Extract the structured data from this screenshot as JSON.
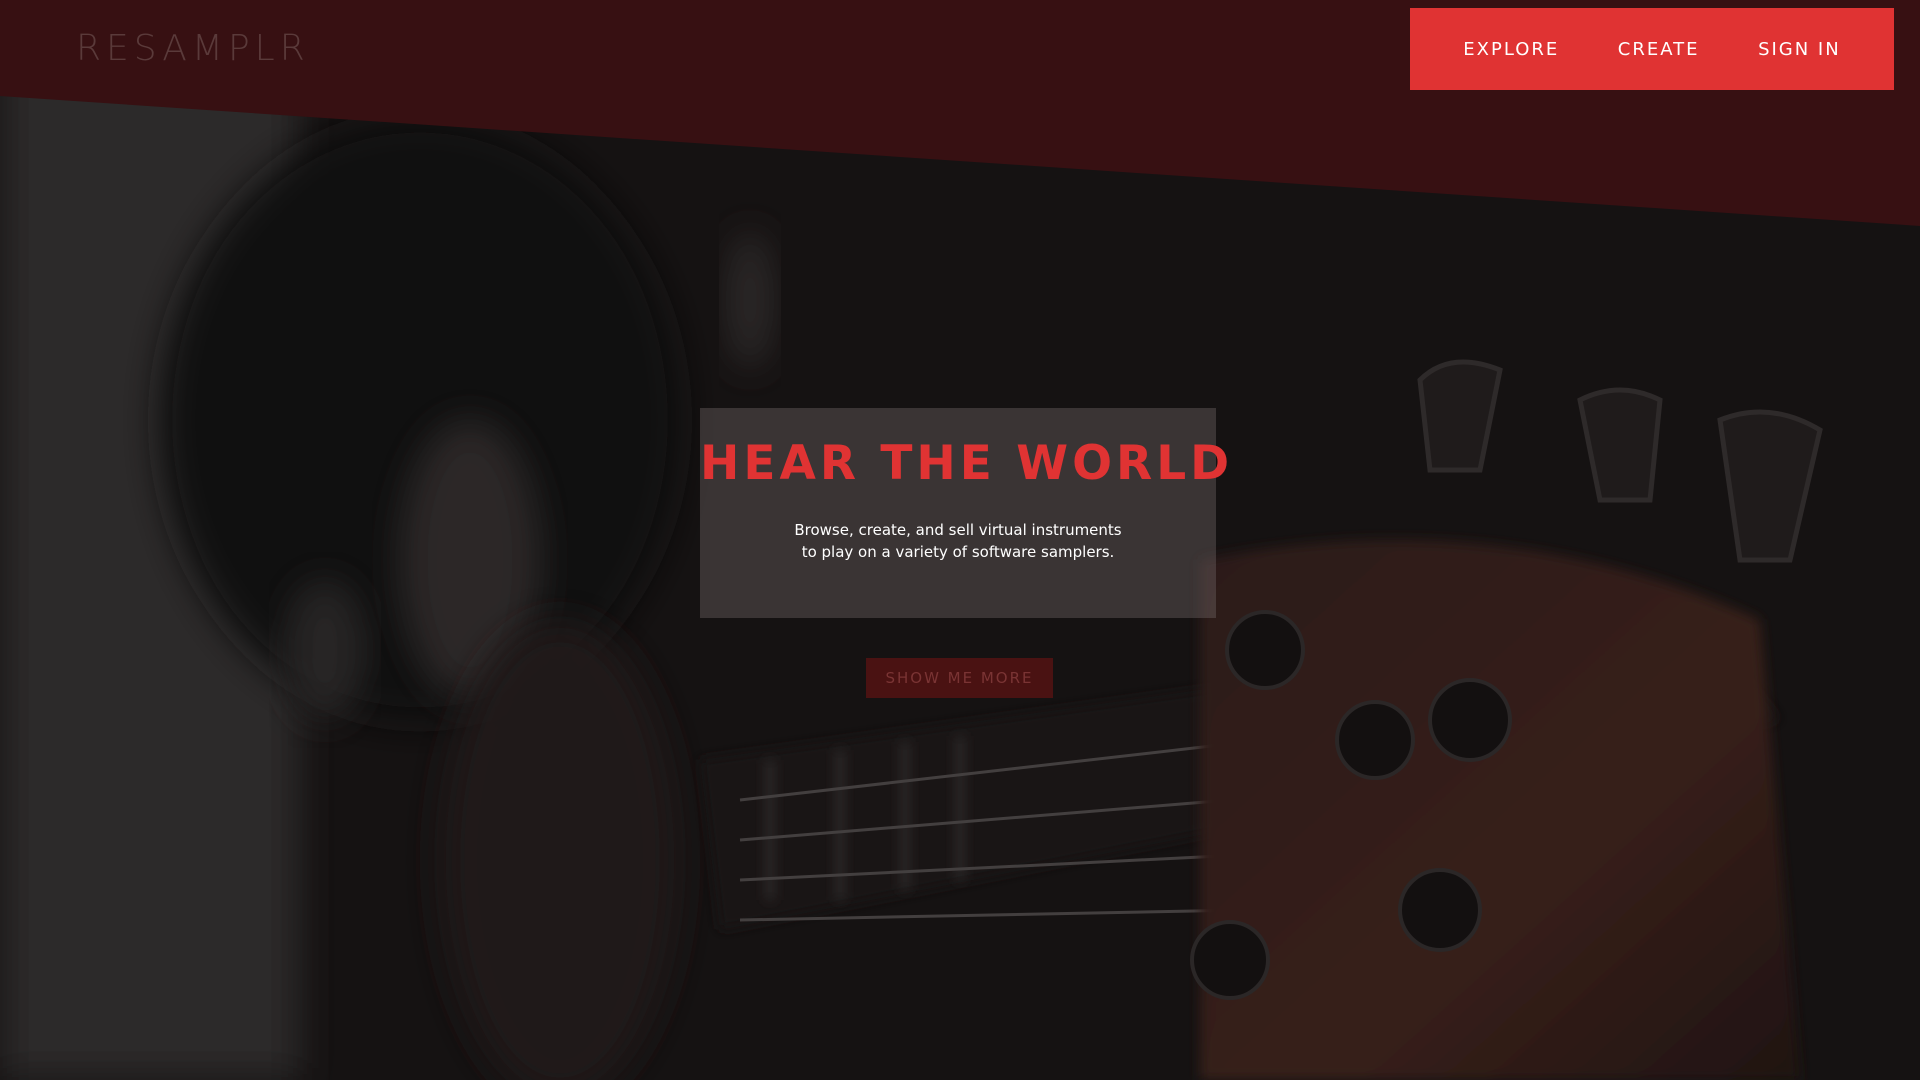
{
  "header": {
    "logo": "RESAMPLR",
    "nav": [
      {
        "label": "EXPLORE"
      },
      {
        "label": "CREATE"
      },
      {
        "label": "SIGN IN"
      }
    ]
  },
  "hero": {
    "title": "HEAR THE WORLD",
    "subtitle": "Browse, create, and sell virtual instruments to play on a variety of software samplers.",
    "cta_label": "SHOW ME MORE",
    "background_image": "bass-guitar-headstock-photo"
  },
  "colors": {
    "accent": "#e03333",
    "header_band": "#371012",
    "overlay": "#1a1414",
    "button_bg": "#4a1212"
  }
}
